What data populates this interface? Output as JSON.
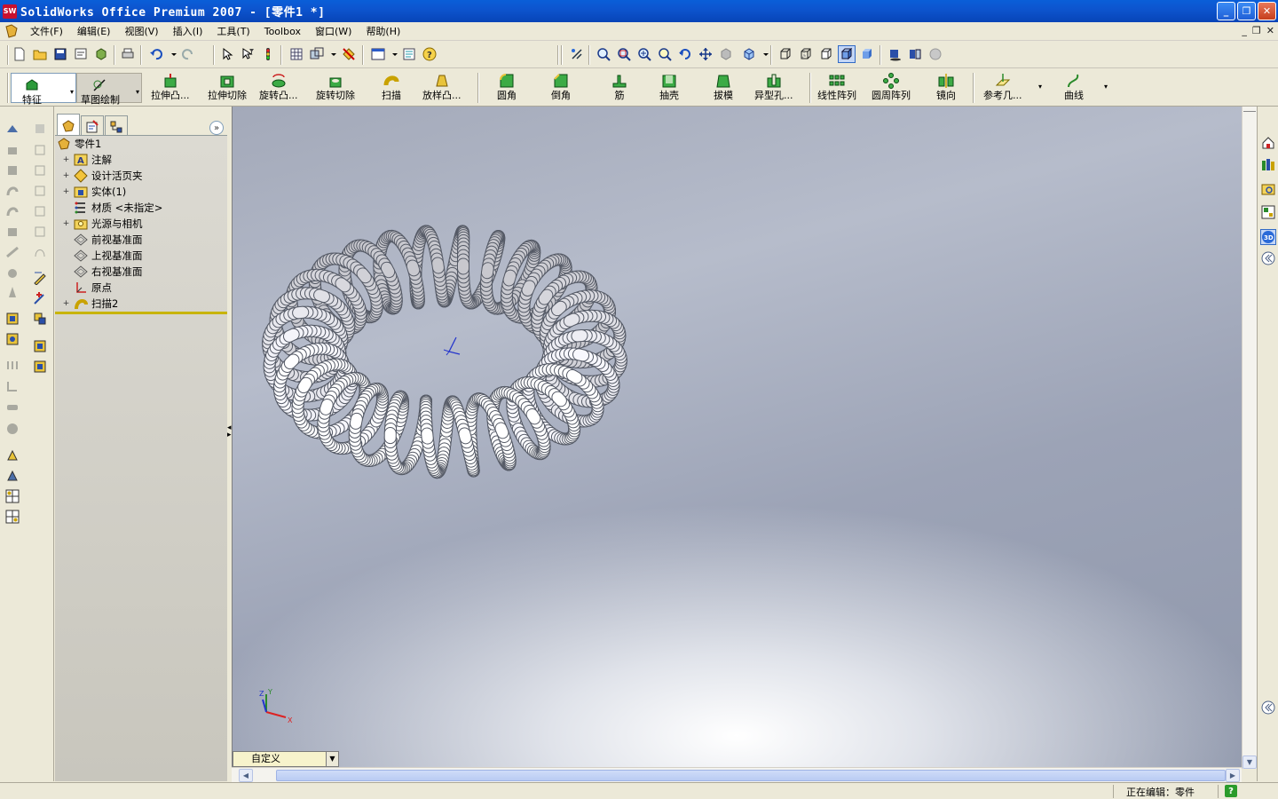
{
  "window": {
    "app_icon_text": "SW",
    "title": "SolidWorks Office Premium 2007 - [零件1 *]",
    "minimize": "_",
    "maximize": "❐",
    "close": "✕"
  },
  "menu": {
    "items": [
      "文件(F)",
      "编辑(E)",
      "视图(V)",
      "插入(I)",
      "工具(T)",
      "Toolbox",
      "窗口(W)",
      "帮助(H)"
    ],
    "mdi_controls": [
      "_",
      "❐",
      "✕"
    ]
  },
  "feature_toolbar": {
    "tabs": [
      "特征",
      "草图绘制"
    ],
    "buttons": [
      "拉伸凸...",
      "拉伸切除",
      "旋转凸...",
      "旋转切除",
      "扫描",
      "放样凸...",
      "圆角",
      "倒角",
      "筋",
      "抽壳",
      "拔模",
      "异型孔...",
      "线性阵列",
      "圆周阵列",
      "镜向",
      "参考几...",
      "曲线"
    ]
  },
  "feature_tree": {
    "root": "零件1",
    "items": [
      {
        "label": "注解",
        "expandable": true,
        "icon": "annotation-icon"
      },
      {
        "label": "设计活页夹",
        "expandable": true,
        "icon": "design-binder-icon"
      },
      {
        "label": "实体(1)",
        "expandable": true,
        "icon": "solid-bodies-icon"
      },
      {
        "label": "材质 <未指定>",
        "expandable": false,
        "icon": "material-icon"
      },
      {
        "label": "光源与相机",
        "expandable": true,
        "icon": "lights-cameras-icon"
      },
      {
        "label": "前视基准面",
        "expandable": false,
        "icon": "plane-icon"
      },
      {
        "label": "上视基准面",
        "expandable": false,
        "icon": "plane-icon"
      },
      {
        "label": "右视基准面",
        "expandable": false,
        "icon": "plane-icon"
      },
      {
        "label": "原点",
        "expandable": false,
        "icon": "origin-icon"
      },
      {
        "label": "扫描2",
        "expandable": true,
        "icon": "sweep-icon"
      }
    ]
  },
  "graphics": {
    "view_orientation": "自定义",
    "triad": {
      "x": "X",
      "y": "Y",
      "z": "Z"
    }
  },
  "status": {
    "editing": "正在编辑：零件",
    "help": "?"
  },
  "colors": {
    "title_bar": "#0a5fd8",
    "chrome": "#ece9d8",
    "model": "#f2f3f7"
  }
}
